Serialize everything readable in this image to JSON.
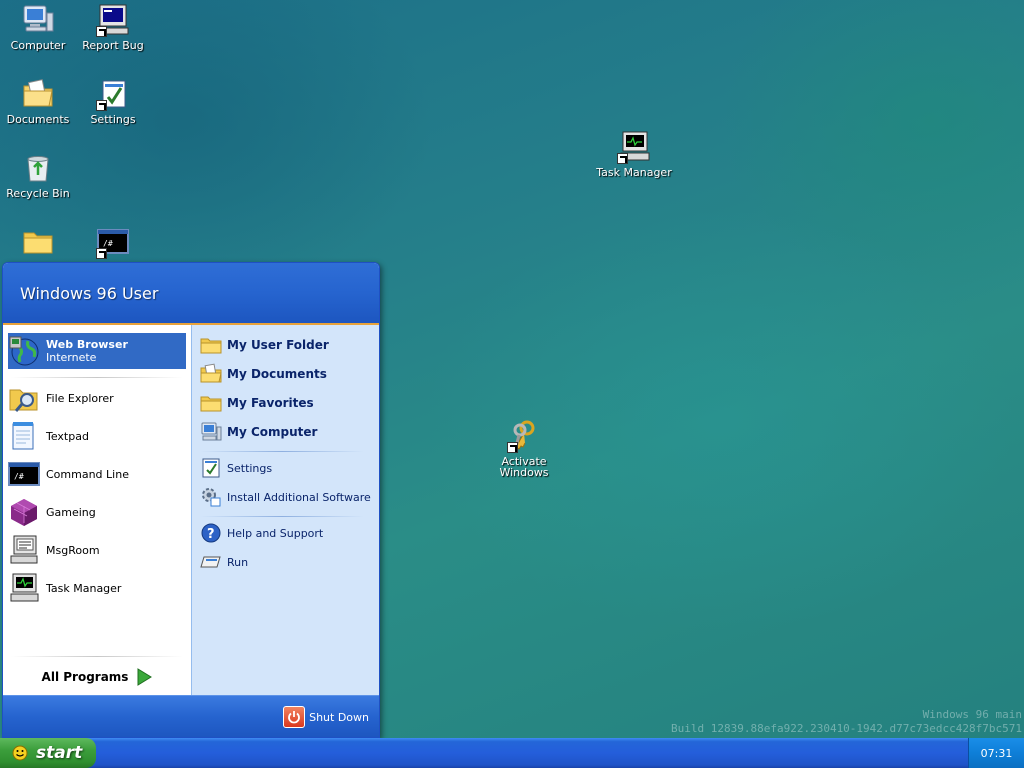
{
  "desktop": {
    "icons": [
      {
        "label": "Computer",
        "icon": "computer-icon"
      },
      {
        "label": "Report Bug",
        "icon": "monitor-icon"
      },
      {
        "label": "Documents",
        "icon": "documents-folder-icon"
      },
      {
        "label": "Settings",
        "icon": "settings-icon"
      },
      {
        "label": "Recycle Bin",
        "icon": "recycle-bin-icon"
      },
      {
        "label": "",
        "icon": "folder-icon"
      },
      {
        "label": "",
        "icon": "terminal-icon"
      },
      {
        "label": "Task Manager",
        "icon": "task-manager-icon"
      },
      {
        "label": "Activate Windows",
        "icon": "keys-icon"
      }
    ]
  },
  "watermark": {
    "line1": "Windows 96 main",
    "line2": "Build 12839.88efa922.230410-1942.d77c73edcc428f7bc571"
  },
  "start_menu": {
    "user_name": "Windows 96 User",
    "pinned": {
      "title": "Web Browser",
      "subtitle": "Internete",
      "icon": "web-browser-icon"
    },
    "programs": [
      {
        "label": "File Explorer",
        "icon": "file-explorer-icon"
      },
      {
        "label": "Textpad",
        "icon": "notepad-icon"
      },
      {
        "label": "Command Line",
        "icon": "terminal-icon"
      },
      {
        "label": "Gameing",
        "icon": "game-cube-icon"
      },
      {
        "label": "MsgRoom",
        "icon": "msgroom-icon"
      },
      {
        "label": "Task Manager",
        "icon": "task-manager-icon"
      }
    ],
    "all_programs": "All Programs",
    "places": [
      {
        "label": "My User Folder",
        "icon": "folder-icon"
      },
      {
        "label": "My Documents",
        "icon": "documents-folder-icon"
      },
      {
        "label": "My Favorites",
        "icon": "favorites-folder-icon"
      },
      {
        "label": "My Computer",
        "icon": "computer-icon"
      }
    ],
    "system": [
      {
        "label": "Settings",
        "icon": "settings-icon"
      },
      {
        "label": "Install Additional Software",
        "icon": "gear-install-icon"
      }
    ],
    "help": [
      {
        "label": "Help and Support",
        "icon": "help-icon"
      },
      {
        "label": "Run",
        "icon": "run-icon"
      }
    ],
    "shutdown_label": "Shut Down"
  },
  "taskbar": {
    "start_label": "start",
    "clock": "07:31"
  },
  "colors": {
    "taskbar_blue": "#245edb",
    "start_green": "#3c9e3c",
    "highlight": "#316ac5",
    "menu_right_panel": "#d3e5fa"
  }
}
